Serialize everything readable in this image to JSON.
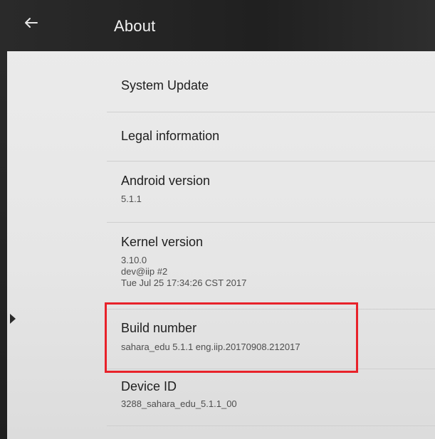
{
  "appbar": {
    "back_icon": "arrow-left-icon",
    "title": "About"
  },
  "settings": [
    {
      "title": "System Update"
    },
    {
      "title": "Legal information"
    },
    {
      "title": "Android version",
      "summary": [
        "5.1.1"
      ]
    },
    {
      "title": "Kernel version",
      "summary": [
        "3.10.0",
        "dev@iip #2",
        "Tue Jul 25 17:34:26 CST 2017"
      ]
    },
    {
      "title": "Build number",
      "summary": [
        "sahara_edu 5.1.1 eng.iip.20170908.212017"
      ]
    },
    {
      "title": "Device ID",
      "summary": [
        "3288_sahara_edu_5.1.1_00"
      ]
    }
  ],
  "annotation": {
    "highlight_color": "#e8222a",
    "highlighted_item": "Build number"
  },
  "colors": {
    "appbar": "#232323",
    "background": "#e9e9e9",
    "divider": "#cfcfcf"
  }
}
